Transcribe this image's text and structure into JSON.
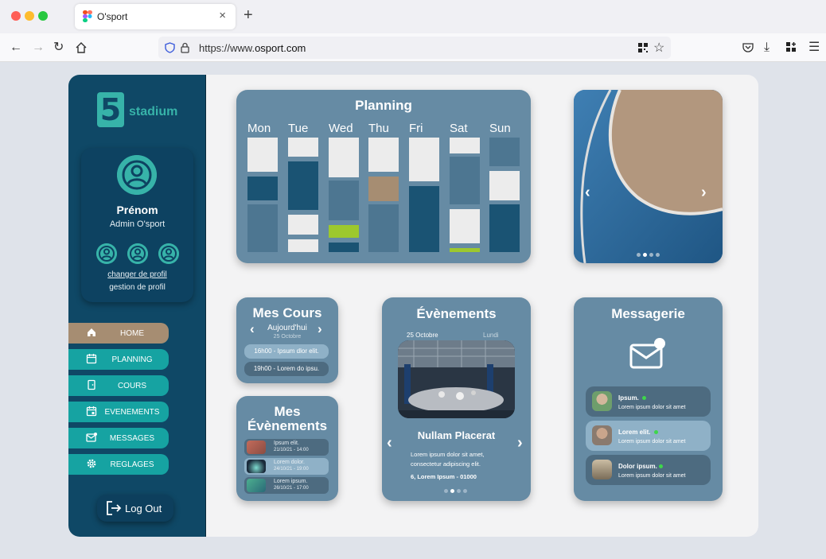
{
  "browser": {
    "tab_title": "O'sport",
    "url": "https://www.",
    "url_domain": "osport.com"
  },
  "sidebar": {
    "logo_text": "stadium",
    "logo_letter": "5",
    "profile": {
      "name": "Prénom",
      "role": "Admin O'sport",
      "change_link": "changer de profil",
      "manage_link": "gestion de profil"
    },
    "menu": [
      {
        "label": "HOME",
        "icon": "home-icon"
      },
      {
        "label": "PLANNING",
        "icon": "calendar-icon"
      },
      {
        "label": "COURS",
        "icon": "door-icon"
      },
      {
        "label": "EVENEMENTS",
        "icon": "calendar-event-icon"
      },
      {
        "label": "MESSAGES",
        "icon": "mail-icon"
      },
      {
        "label": "REGLAGES",
        "icon": "gear-icon"
      }
    ],
    "logout": "Log Out"
  },
  "planning": {
    "title": "Planning",
    "days": [
      "Mon",
      "Tue",
      "Wed",
      "Thu",
      "Fri",
      "Sat",
      "Sun"
    ]
  },
  "cours": {
    "title": "Mes Cours",
    "today": "Aujourd'hui",
    "date": "25 Octobre",
    "items": [
      "16h00 - Ipsum dlor elit.",
      "19h00 - Lorem do ipsu."
    ]
  },
  "my_events": {
    "title_line1": "Mes",
    "title_line2": "Évènements",
    "items": [
      {
        "title": "Ipsum elit.",
        "date": "21/10/21 - 14:00"
      },
      {
        "title": "Lorem dolor.",
        "date": "24/10/21 - 19:00"
      },
      {
        "title": "Lorem ipsum.",
        "date": "26/10/21 - 17:00"
      }
    ]
  },
  "events": {
    "title": "Évènements",
    "date": "25 Octobre",
    "weekday": "Lundi",
    "name": "Nullam Placerat",
    "description": "Lorem ipsum dolor sit amet, consectetur adipiscing elit.",
    "info": "6, Lorem Ipsum - 01000"
  },
  "messages": {
    "title": "Messagerie",
    "items": [
      {
        "name": "Ipsum.",
        "text": "Lorem ipsum dolor sit amet"
      },
      {
        "name": "Lorem elit.",
        "text": "Lorem ipsum dolor sit amet"
      },
      {
        "name": "Dolor ipsum.",
        "text": "Lorem ipsum dolor sit amet"
      }
    ]
  },
  "colors": {
    "sidebar": "#0f4866",
    "accent": "#16a3a2",
    "active": "#a68d72",
    "card": "#668ba4"
  }
}
